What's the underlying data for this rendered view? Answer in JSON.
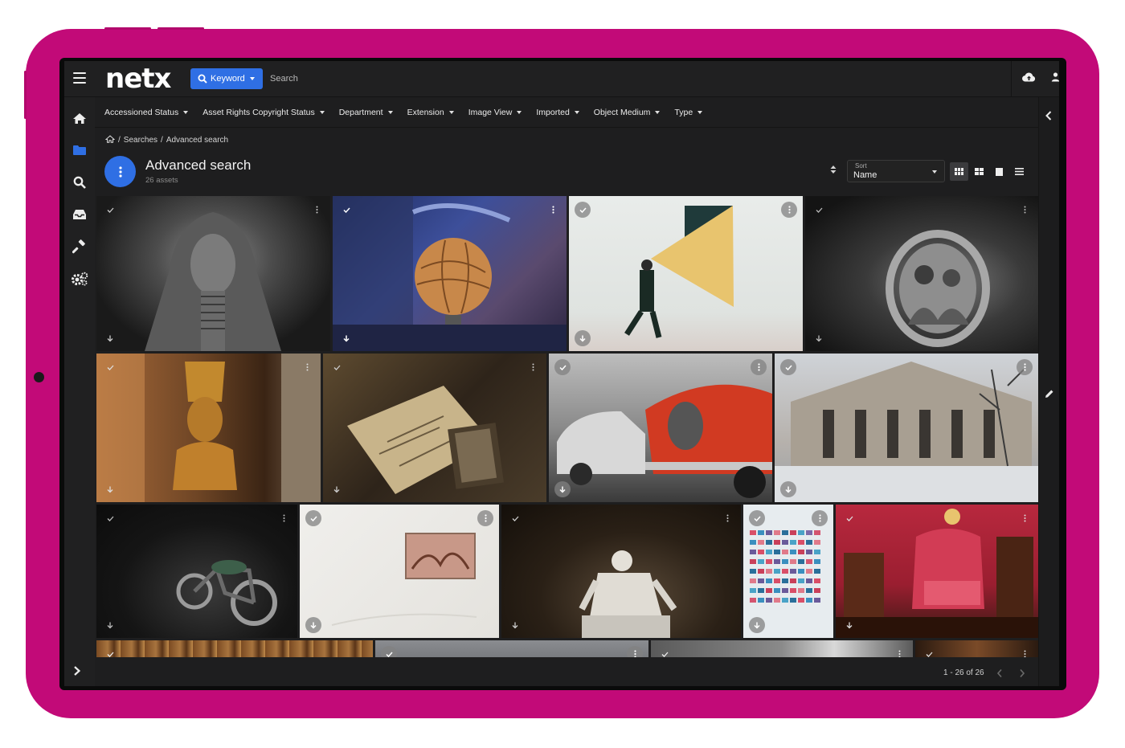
{
  "header": {
    "logo": "netx",
    "search_mode_label": "Keyword",
    "search_placeholder": "Search"
  },
  "filters": [
    "Accessioned Status",
    "Asset Rights Copyright Status",
    "Department",
    "Extension",
    "Image View",
    "Imported",
    "Object Medium",
    "Type"
  ],
  "breadcrumb": {
    "separator": "/",
    "items": [
      "Searches",
      "Advanced search"
    ]
  },
  "page": {
    "title": "Advanced search",
    "subtitle": "26 assets"
  },
  "sort": {
    "label": "Sort",
    "value": "Name"
  },
  "pagination": {
    "range": "1 - 26 of 26"
  },
  "colors": {
    "tablet_frame": "#c20a78",
    "accent": "#2f6fe4",
    "surface": "#1e1e1f"
  }
}
